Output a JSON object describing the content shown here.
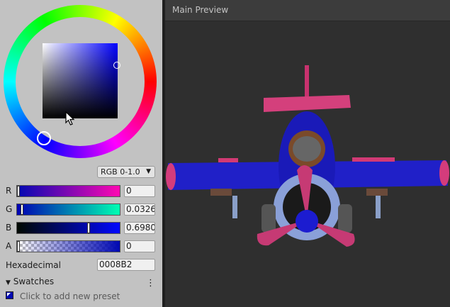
{
  "color_picker": {
    "mode_label": "RGB 0-1.0",
    "channels": [
      {
        "label": "R",
        "value": "0"
      },
      {
        "label": "G",
        "value": "0.0326"
      },
      {
        "label": "B",
        "value": "0.6980"
      },
      {
        "label": "A",
        "value": "0"
      }
    ],
    "hex_label": "Hexadecimal",
    "hex_value": "0008B2",
    "swatches_title": "Swatches",
    "swatches_hint": "Click to add new preset",
    "current_color": "#0008b2"
  },
  "preview": {
    "title": "Main Preview"
  }
}
